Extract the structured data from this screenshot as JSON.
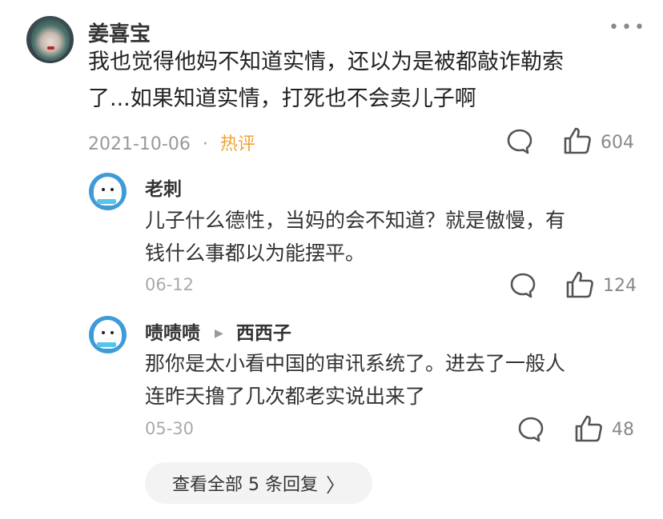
{
  "comment": {
    "username": "姜喜宝",
    "text_line1": "我也觉得他妈不知道实情，还以为是被都敲诈勒索",
    "text_line2": "了...如果知道实情，打死也不会卖儿子啊",
    "date": "2021-10-06",
    "dot": "·",
    "tag": "热评",
    "likes": "604"
  },
  "replies": [
    {
      "username": "老刺",
      "text_line1": "儿子什么德性，当妈的会不知道？就是傲慢，有",
      "text_line2": "钱什么事都以为能摆平。",
      "date": "06-12",
      "likes": "124"
    },
    {
      "username": "啧啧啧",
      "reply_to": "西西子",
      "text_line1": "那你是太小看中国的审讯系统了。进去了一般人",
      "text_line2": "连昨天撸了几次都老实说出来了",
      "date": "05-30",
      "likes": "48"
    }
  ],
  "view_all": "查看全部 5 条回复",
  "icons": {
    "more": "more-icon",
    "comment": "comment-bubble-icon",
    "like": "thumbs-up-icon",
    "chevron": "chevron-right-icon"
  },
  "colors": {
    "hot_tag": "#f0a236",
    "avatar_blue": "#3f9bd8"
  }
}
